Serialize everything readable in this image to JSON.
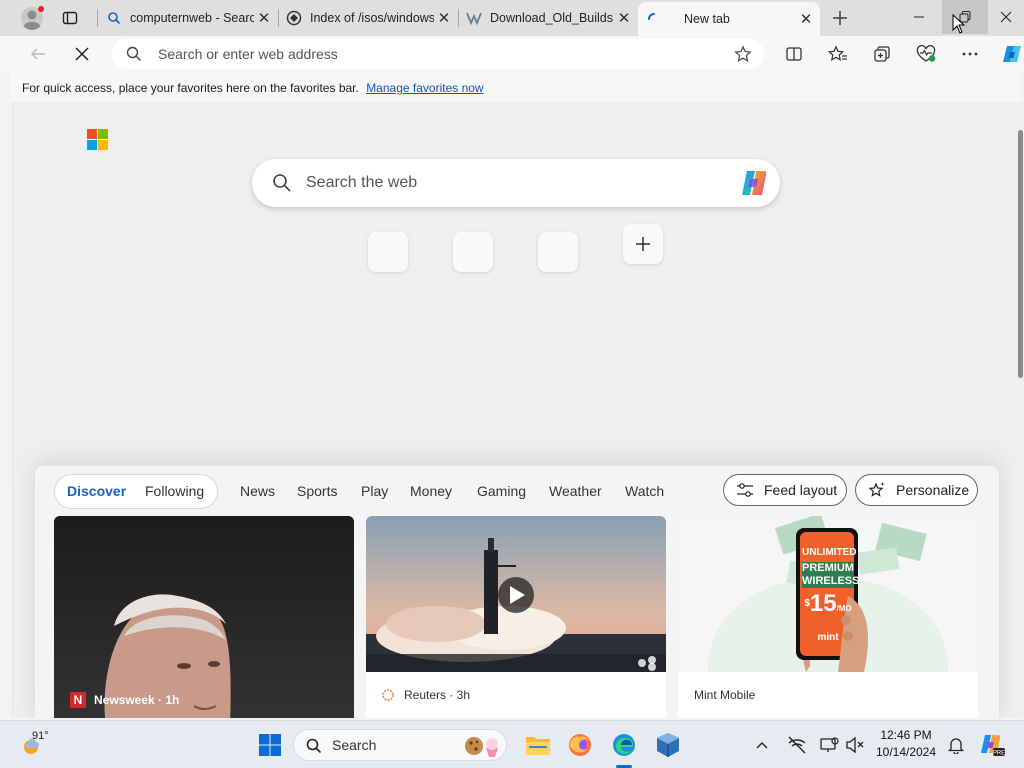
{
  "tabs": [
    {
      "title": "computernweb - Search",
      "favicon": "search-favicon-icon"
    },
    {
      "title": "Index of /isos/windows",
      "favicon": "site-favicon-icon"
    },
    {
      "title": "Download_Old_Builds",
      "favicon": "winworld-favicon-icon"
    },
    {
      "title": "New tab",
      "favicon": "loading-spinner-icon",
      "active": true
    }
  ],
  "toolbar": {
    "address_placeholder": "Search or enter web address"
  },
  "favorites_bar": {
    "message": "For quick access, place your favorites here on the favorites bar.",
    "link": "Manage favorites now"
  },
  "newtab": {
    "search_placeholder": "Search the web",
    "quicklinks_count": 3
  },
  "feed": {
    "tabs": [
      "Discover",
      "Following",
      "News",
      "Sports",
      "Play",
      "Money",
      "Gaming",
      "Weather",
      "Watch"
    ],
    "selected": "Discover",
    "feed_layout_label": "Feed layout",
    "personalize_label": "Personalize",
    "cards": [
      {
        "source": "Newsweek · 1h",
        "headline": ""
      },
      {
        "source": "Reuters · 3h",
        "headline": ""
      },
      {
        "source": "Mint Mobile",
        "headline": "",
        "ad_lines": [
          "UNLIMITED",
          "PREMIUM",
          "WIRELESS",
          "$",
          "15",
          "/MO",
          "mint"
        ]
      }
    ]
  },
  "taskbar": {
    "weather_temp": "91°",
    "search_label": "Search",
    "time": "12:46 PM",
    "date": "10/14/2024"
  },
  "colors": {
    "accent_blue": "#1a62c8",
    "link_blue": "#0b57b5",
    "tab_strip": "#dfdfdf",
    "page_bg": "#efefef"
  }
}
